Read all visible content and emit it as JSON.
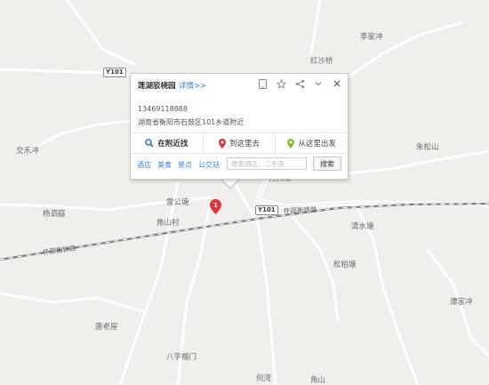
{
  "places": [
    {
      "id": "lijiachong",
      "text": "李家冲"
    },
    {
      "id": "hongshaqiao",
      "text": "红沙桥"
    },
    {
      "id": "jiaomichong",
      "text": "交禾冲"
    },
    {
      "id": "zhusongshan",
      "text": "朱松山"
    },
    {
      "id": "leigongtang",
      "text": "雷公塘"
    },
    {
      "id": "yangsiyi",
      "text": "杨泗嶷"
    },
    {
      "id": "jiaoshancun",
      "text": "角山村"
    },
    {
      "id": "qingshuitang",
      "text": "清水塘"
    },
    {
      "id": "songbaitang",
      "text": "松柏塘"
    },
    {
      "id": "tanjiachong",
      "text": "谭家冲"
    },
    {
      "id": "tanglaowu",
      "text": "唐老屋"
    },
    {
      "id": "baziqiaomen",
      "text": "八字榴门"
    },
    {
      "id": "hewan",
      "text": "何湾"
    },
    {
      "id": "jiaoshan",
      "text": "角山"
    },
    {
      "id": "xiaojiaoling",
      "text": "肖大垅"
    }
  ],
  "roads": {
    "y101_label": "Y101",
    "railway_label": "怀邵衡铁路"
  },
  "marker": {
    "number": "1"
  },
  "popup": {
    "title": "莲湖驳桡园",
    "detail_link": "详情>>",
    "phone": "13469118888",
    "address": "湖南省衡阳市石鼓区101乡道附近",
    "actions": {
      "nearby": "在附近找",
      "go_here": "到这里去",
      "from_here": "从这里出发"
    },
    "tabs": [
      "酒店",
      "美食",
      "景点",
      "公交站"
    ],
    "search_placeholder": "搜索酒店、二手房",
    "search_button": "搜索",
    "icons": [
      "phone-icon",
      "star-icon",
      "share-icon",
      "collapse-icon",
      "close-icon"
    ]
  },
  "colors": {
    "map_bg": "#f1efeb",
    "road": "#ffffff",
    "railway": "#7d7d7d",
    "marker": "#e0343a",
    "link": "#3a7fd5"
  }
}
